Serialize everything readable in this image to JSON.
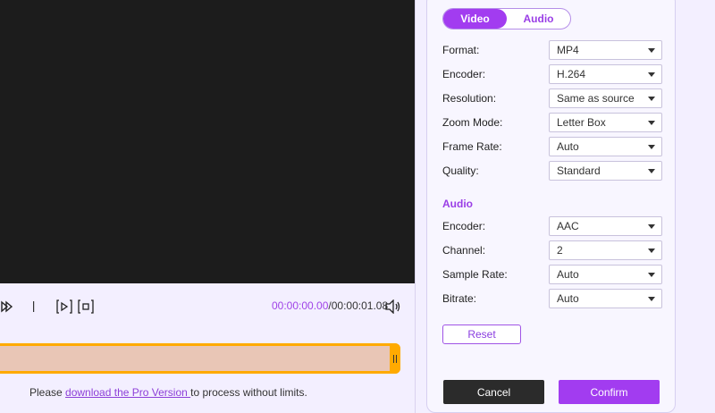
{
  "player": {
    "time_current": "00:00:00.00",
    "time_total": "/00:00:01.08"
  },
  "icons": {
    "step_forward": "step-forward-icon",
    "separator": "separator-bar",
    "play_selection": "play-selection-icon",
    "stop_selection": "stop-selection-icon",
    "volume": "volume-icon",
    "handle": "timeline-handle-grip"
  },
  "pro_note": {
    "prefix": "Please ",
    "link": "download the Pro Version ",
    "suffix": "to process without limits."
  },
  "settings": {
    "tabs": [
      {
        "label": "Video",
        "active": true
      },
      {
        "label": "Audio",
        "active": false
      }
    ],
    "video": [
      {
        "label": "Format:",
        "value": "MP4"
      },
      {
        "label": "Encoder:",
        "value": "H.264"
      },
      {
        "label": "Resolution:",
        "value": "Same as source"
      },
      {
        "label": "Zoom Mode:",
        "value": "Letter Box"
      },
      {
        "label": "Frame Rate:",
        "value": "Auto"
      },
      {
        "label": "Quality:",
        "value": "Standard"
      }
    ],
    "audio_title": "Audio",
    "audio": [
      {
        "label": "Encoder:",
        "value": "AAC"
      },
      {
        "label": "Channel:",
        "value": "2"
      },
      {
        "label": "Sample Rate:",
        "value": "Auto"
      },
      {
        "label": "Bitrate:",
        "value": "Auto"
      }
    ],
    "reset_label": "Reset",
    "cancel_label": "Cancel",
    "confirm_label": "Confirm"
  },
  "colors": {
    "accent": "#a23cf0",
    "timeline_border": "#ffaa00",
    "timeline_fill": "#e9c6b6"
  }
}
